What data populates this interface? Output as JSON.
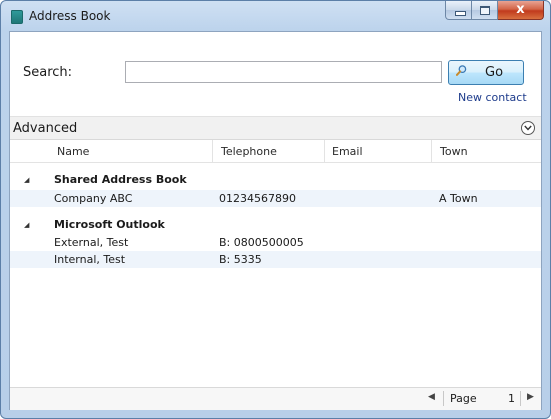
{
  "window": {
    "title": "Address Book",
    "close_glyph": "x"
  },
  "search": {
    "label": "Search:",
    "value": "",
    "placeholder": "",
    "go_label": "Go",
    "new_contact": "New contact"
  },
  "advanced": {
    "label": "Advanced"
  },
  "columns": {
    "name": "Name",
    "telephone": "Telephone",
    "email": "Email",
    "town": "Town"
  },
  "groups": [
    {
      "name": "Shared Address Book",
      "rows": [
        {
          "name": "Company ABC",
          "telephone": "01234567890",
          "email": "",
          "town": "A Town"
        }
      ]
    },
    {
      "name": "Microsoft Outlook",
      "rows": [
        {
          "name": "External, Test",
          "telephone": "B: 0800500005",
          "email": "",
          "town": ""
        },
        {
          "name": "Internal, Test",
          "telephone": "B: 5335",
          "email": "",
          "town": ""
        }
      ]
    }
  ],
  "pager": {
    "label": "Page",
    "page": "1"
  },
  "icons": {
    "app": "address-book-icon",
    "search": "magnifier-icon",
    "expand": "chevron-down-icon",
    "collapse": "triangle-collapse-icon"
  }
}
